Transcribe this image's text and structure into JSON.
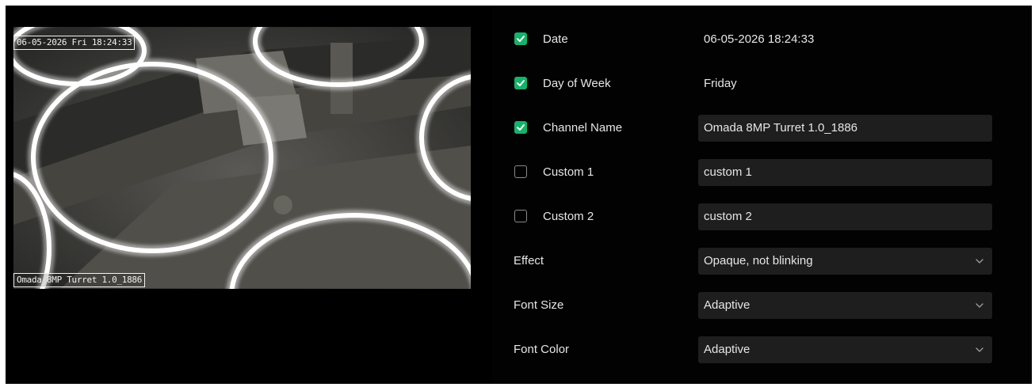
{
  "preview": {
    "osd_top_text": "06-05-2026 Fri 18:24:33",
    "osd_bottom_text": "Omada 8MP Turret 1.0_1886"
  },
  "settings": {
    "date": {
      "label": "Date",
      "checked": true,
      "value": "06-05-2026 18:24:33"
    },
    "day_of_week": {
      "label": "Day of Week",
      "checked": true,
      "value": "Friday"
    },
    "channel_name": {
      "label": "Channel Name",
      "checked": true,
      "value": "Omada 8MP Turret 1.0_1886"
    },
    "custom1": {
      "label": "Custom 1",
      "checked": false,
      "value": "custom 1"
    },
    "custom2": {
      "label": "Custom 2",
      "checked": false,
      "value": "custom 2"
    },
    "effect": {
      "label": "Effect",
      "value": "Opaque, not blinking"
    },
    "font_size": {
      "label": "Font Size",
      "value": "Adaptive"
    },
    "font_color": {
      "label": "Font Color",
      "value": "Adaptive"
    }
  },
  "colors": {
    "accent_green": "#17b26a",
    "background": "#000000",
    "field_background": "#1e1e1e",
    "text": "#e6e6e6"
  },
  "icons": {
    "checkbox_checked": "checkmark-icon",
    "dropdown": "chevron-down-icon"
  }
}
